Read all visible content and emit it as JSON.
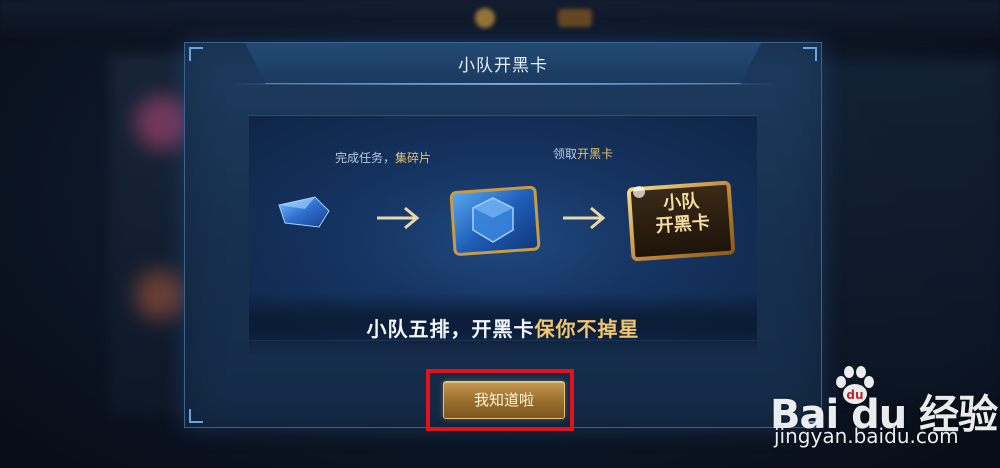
{
  "dialog": {
    "title": "小队开黑卡",
    "steps": {
      "collect_prefix": "完成任务，",
      "collect_highlight": "集碎片",
      "claim_prefix": "领取",
      "claim_highlight": "开黑卡"
    },
    "card_text_line1": "小队",
    "card_text_line2": "开黑卡",
    "slogan_prefix": "小队五排，开黑卡",
    "slogan_highlight": "保你不掉星",
    "confirm_button": "我知道啦"
  },
  "watermark": {
    "logo": "Bai du 经验",
    "url": "jingyan.baidu.com"
  },
  "colors": {
    "accent_gold": "#e8c06a",
    "highlight_red": "#e0121b",
    "panel_blue": "#1d3b5e"
  }
}
